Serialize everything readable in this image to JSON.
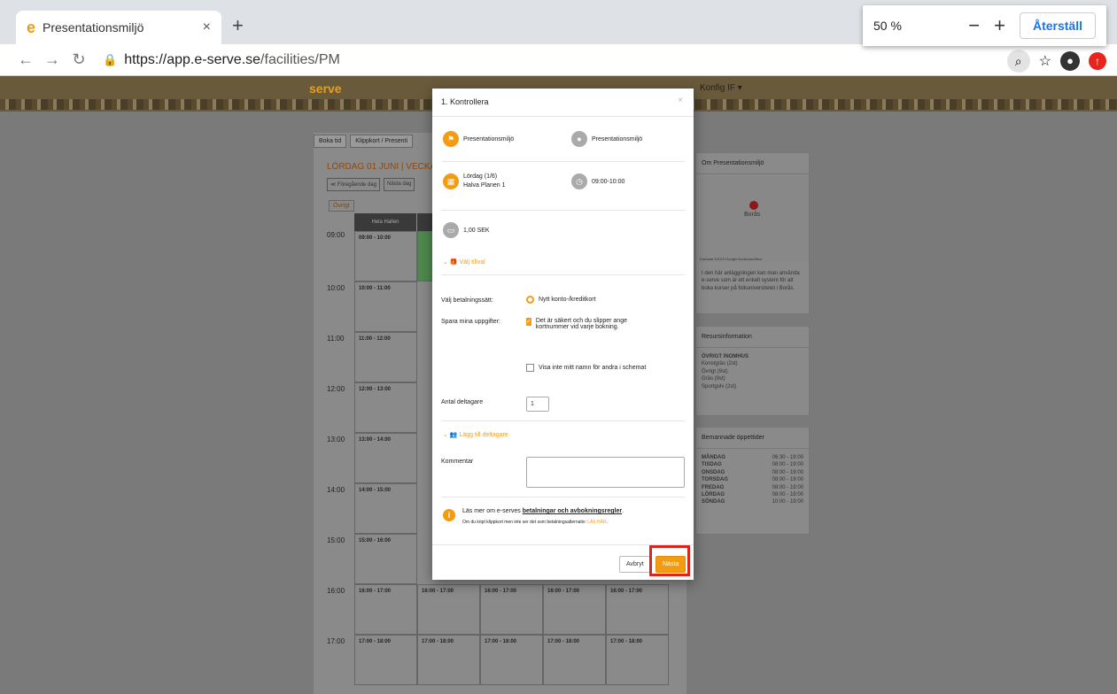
{
  "browser": {
    "tab_title": "Presentationsmiljö",
    "tab_close": "×",
    "new_tab": "+",
    "url_host": "https://app.e-serve.se",
    "url_path": "/facilities/PM",
    "zoom": {
      "percent": "50 %",
      "minus": "−",
      "plus": "+",
      "reset": "Återställ"
    }
  },
  "site": {
    "logo": "serve",
    "topright": "Konfig IF ▾",
    "tabs": [
      "Boka tid",
      "Klippkort / Presenti"
    ],
    "day_title": "LÖRDAG 01 JUNI  |  VECKA 2",
    "prev_day": "≪ Föregående dag",
    "next_day": "Nästa dag",
    "ovrigt": "Övrigt",
    "col_head": "Hela Hallen",
    "times": [
      "09:00",
      "10:00",
      "11:00",
      "12:00",
      "13:00",
      "14:00",
      "15:00",
      "16:00",
      "17:00"
    ],
    "slots": [
      "09:00 - 10:00",
      "10:00 - 11:00",
      "11:00 - 12:00",
      "12:00 - 13:00",
      "13:00 - 14:00",
      "14:00 - 15:00",
      "15:00 - 16:00",
      "16:00 - 17:00",
      "17:00 - 18:00"
    ],
    "extra_slots_16": [
      "16:00 - 17:00",
      "16:00 - 17:00",
      "16:00 - 17:00",
      "16:00 - 17:00"
    ],
    "extra_slots_17": [
      "17:00 - 18:00",
      "17:00 - 18:00",
      "17:00 - 18:00",
      "17:00 - 18:00"
    ],
    "side": {
      "about_title": "Om Presentationsmiljö",
      "map_city": "Borås",
      "map_credit": "Kartdata ©2019 Google   Användarvillkor",
      "about_text": "I den här anläggningen kan man använda e-serve som är ett enkelt system för att boka kurser på folkuniversitetet i Borås.",
      "resource_title": "Resursinformation",
      "resource_head": "ÖVRIGT INOMHUS",
      "resource_items": [
        "Konstgräs (2st)",
        "Övrigt (9st)",
        "Gräs (9st)",
        "Sportgolv (2st)"
      ],
      "hours_title": "Bemannade öppettider",
      "hours": [
        {
          "day": "MÅNDAG",
          "time": "06:30 - 19:00"
        },
        {
          "day": "TISDAG",
          "time": "08:00 - 19:00"
        },
        {
          "day": "ONSDAG",
          "time": "08:00 - 19:00"
        },
        {
          "day": "TORSDAG",
          "time": "08:00 - 19:00"
        },
        {
          "day": "FREDAG",
          "time": "08:00 - 19:00"
        },
        {
          "day": "LÖRDAG",
          "time": "08:00 - 19:00"
        },
        {
          "day": "SÖNDAG",
          "time": "10:00 - 19:00"
        }
      ]
    }
  },
  "modal": {
    "title": "1. Kontrollera",
    "close": "×",
    "object": "Presentationsmiljö",
    "location": "Presentationsmiljö",
    "date": "Lördag (1/6)",
    "place": "Halva Planen 1",
    "time": "09:00-10:00",
    "price": "1,00 SEK",
    "choose_extras": "Välj tillval",
    "payment_label": "Välj betalningssätt:",
    "payment_option": "Nytt konto-/kreditkort",
    "save_label": "Spara mina uppgifter:",
    "save_text": "Det är säkert och du slipper ange kortnummer vid varje bokning.",
    "hide_name": "Visa inte mitt namn för andra i schemat",
    "participants_label": "Antal deltagare",
    "participants_value": "1",
    "add_participants": "Lägg till deltagare",
    "comment_label": "Kommentar",
    "info_prefix": "Läs mer om e-serves ",
    "info_link": "betalningar och avbokningsregler",
    "info_suffix": ".",
    "small_prefix": "Om du köpt klippkort men inte ser det som betalningsalternativ: ",
    "small_link": "LÄS HÄR",
    "small_suffix": ".",
    "cancel": "Avbryt",
    "next": "Nästa"
  }
}
